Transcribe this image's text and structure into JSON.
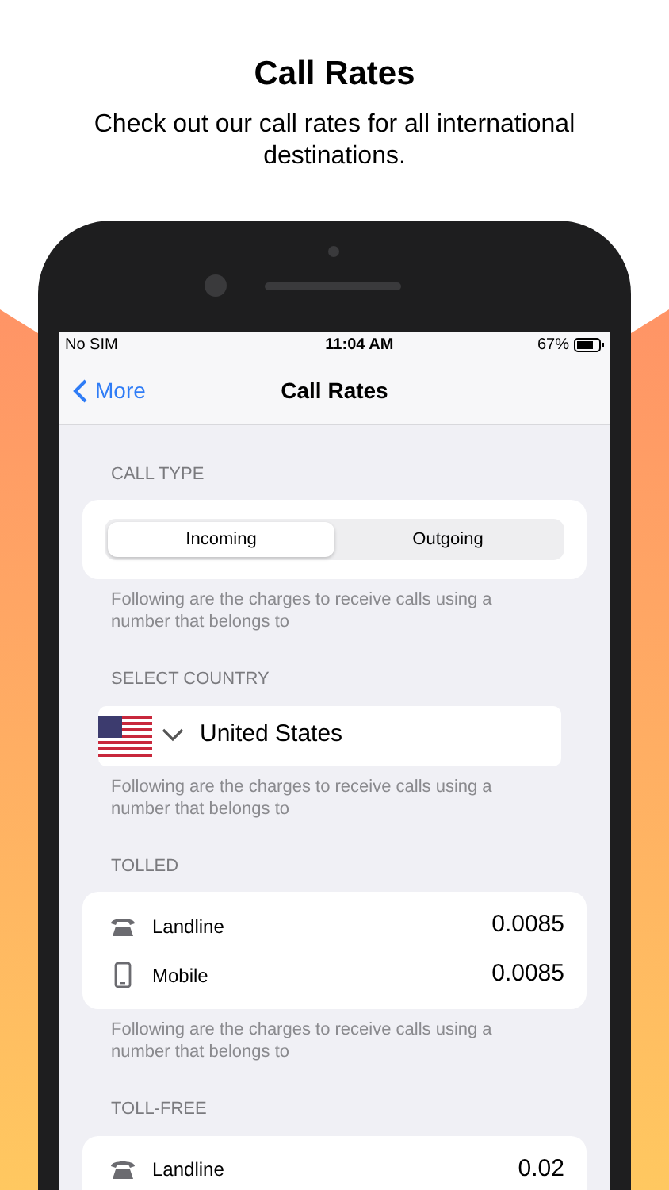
{
  "headline": "Call Rates",
  "subtitle": "Check out our call rates for all international destinations.",
  "status_bar": {
    "carrier": "No SIM",
    "time": "11:04 AM",
    "battery": "67%"
  },
  "nav": {
    "back": "More",
    "title": "Call Rates"
  },
  "sections": [
    {
      "kind": "segmented",
      "header": "CALL TYPE",
      "segments": [
        {
          "label": "Incoming",
          "selected": true
        },
        {
          "label": "Outgoing",
          "selected": false
        }
      ],
      "note": "Following are the charges to receive calls using a number that belongs to"
    },
    {
      "kind": "country",
      "header": "SELECT COUNTRY",
      "country": "United States",
      "note": "Following are the charges to receive calls using a number that belongs to"
    },
    {
      "kind": "rates",
      "header": "TOLLED",
      "rows": [
        {
          "kind": "landline",
          "label": "Landline",
          "rate": "0.0085"
        },
        {
          "kind": "mobile",
          "label": "Mobile",
          "rate": "0.0085"
        }
      ],
      "note": "Following are the charges to receive calls using a number that belongs to"
    },
    {
      "kind": "rates",
      "header": "TOLL-FREE",
      "rows": [
        {
          "kind": "landline",
          "label": "Landline",
          "rate": "0.02"
        }
      ]
    }
  ]
}
